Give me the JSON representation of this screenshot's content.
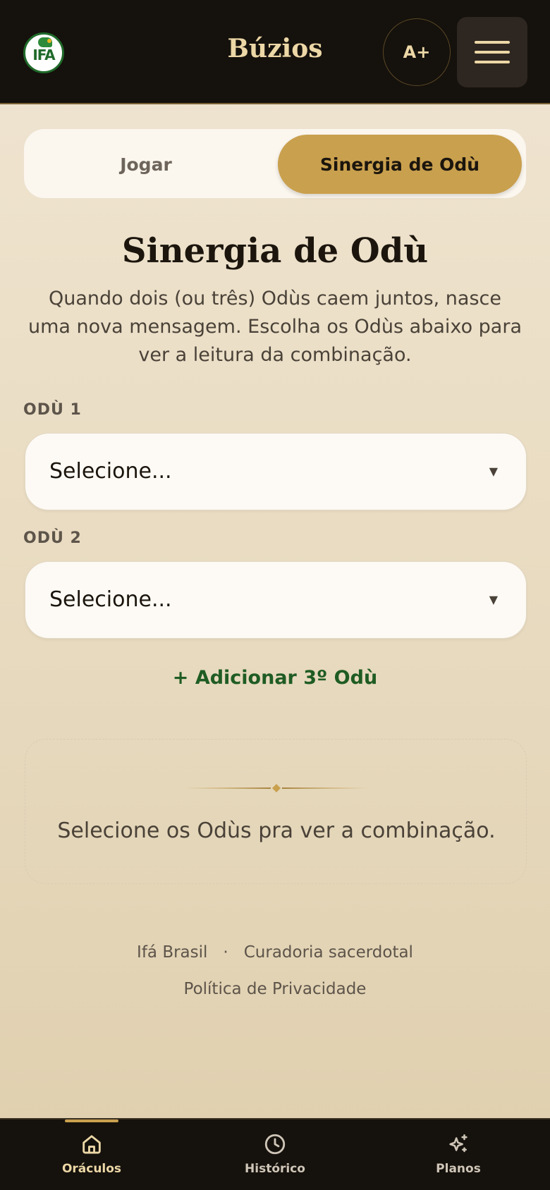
{
  "header": {
    "logo_text": "IFA",
    "title": "Búzios",
    "font_button_label": "A+",
    "menu_icon": "hamburger-menu-icon"
  },
  "tabs": [
    {
      "label": "Jogar",
      "active": false
    },
    {
      "label": "Sinergia de Odù",
      "active": true
    }
  ],
  "main": {
    "title": "Sinergia de Odù",
    "description": "Quando dois (ou três) Odùs caem juntos, nasce uma nova mensagem. Escolha os Odùs abaixo para ver a leitura da combinação.",
    "fields": [
      {
        "label": "ODÙ 1",
        "value": "Selecione..."
      },
      {
        "label": "ODÙ 2",
        "value": "Selecione..."
      }
    ],
    "add_link": "+ Adicionar 3º Odù",
    "result_placeholder": "Selecione os Odùs pra ver a combinação."
  },
  "footer": {
    "brand": "Ifá Brasil",
    "separator": "·",
    "curation": "Curadoria sacerdotal",
    "privacy": "Política de Privacidade"
  },
  "bottom_nav": {
    "items": [
      {
        "label": "Oráculos",
        "icon": "home-icon",
        "active": true
      },
      {
        "label": "Histórico",
        "icon": "clock-icon",
        "active": false
      },
      {
        "label": "Planos",
        "icon": "sparkles-icon",
        "active": false
      }
    ]
  },
  "colors": {
    "header_bg": "#15110c",
    "accent_gold": "#c9a04e",
    "link_green": "#1f5c23",
    "title_gold": "#ecd7a6"
  }
}
